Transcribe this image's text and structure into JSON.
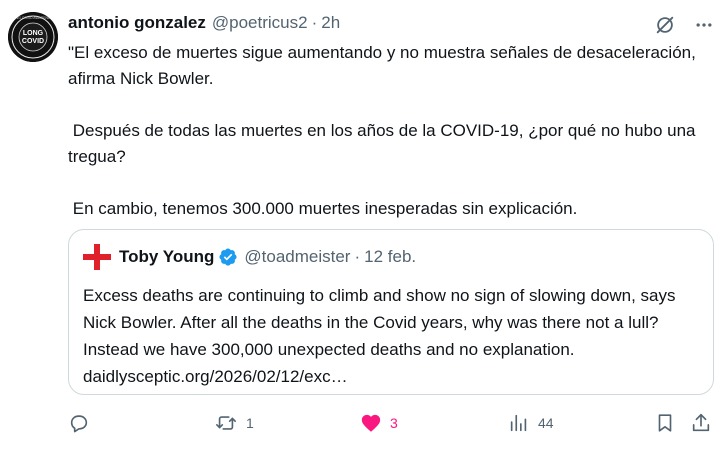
{
  "tweet": {
    "author_name": "antonio gonzalez",
    "author_handle": "@poetricus2",
    "time": "2h",
    "text": "\"El exceso de muertes sigue aumentando y no muestra señales de desaceleración, afirma Nick Bowler.\n\n Después de todas las muertes en los años de la COVID-19, ¿por qué no hubo una tregua?\n\n En cambio, tenemos 300.000 muertes inesperadas sin explicación.",
    "avatar_text": [
      "LONG",
      "COVID"
    ],
    "avatar_ring_text": "LONG COVID AWARENESS"
  },
  "quote": {
    "author_name": "Toby Young",
    "author_handle": "@toadmeister",
    "date": "12 feb.",
    "text": "Excess deaths are continuing to climb and show no sign of slowing down, says Nick Bowler. After all the deaths in the Covid years, why was there not a lull? Instead we have 300,000 unexpected deaths and no explanation. daidlysceptic.org/2026/02/12/exc…",
    "flag_color": "#e0202a",
    "verified_color": "#1d9bf0"
  },
  "actions": {
    "replies": "",
    "retweets": "1",
    "likes": "3",
    "views": "44"
  },
  "colors": {
    "text": "#0f1419",
    "secondary": "#536471",
    "like": "#f91880",
    "border": "#cfd9de"
  },
  "icons": [
    "grok-icon",
    "more-icon",
    "reply-icon",
    "retweet-icon",
    "heart-icon",
    "views-icon",
    "bookmark-icon",
    "share-icon"
  ]
}
